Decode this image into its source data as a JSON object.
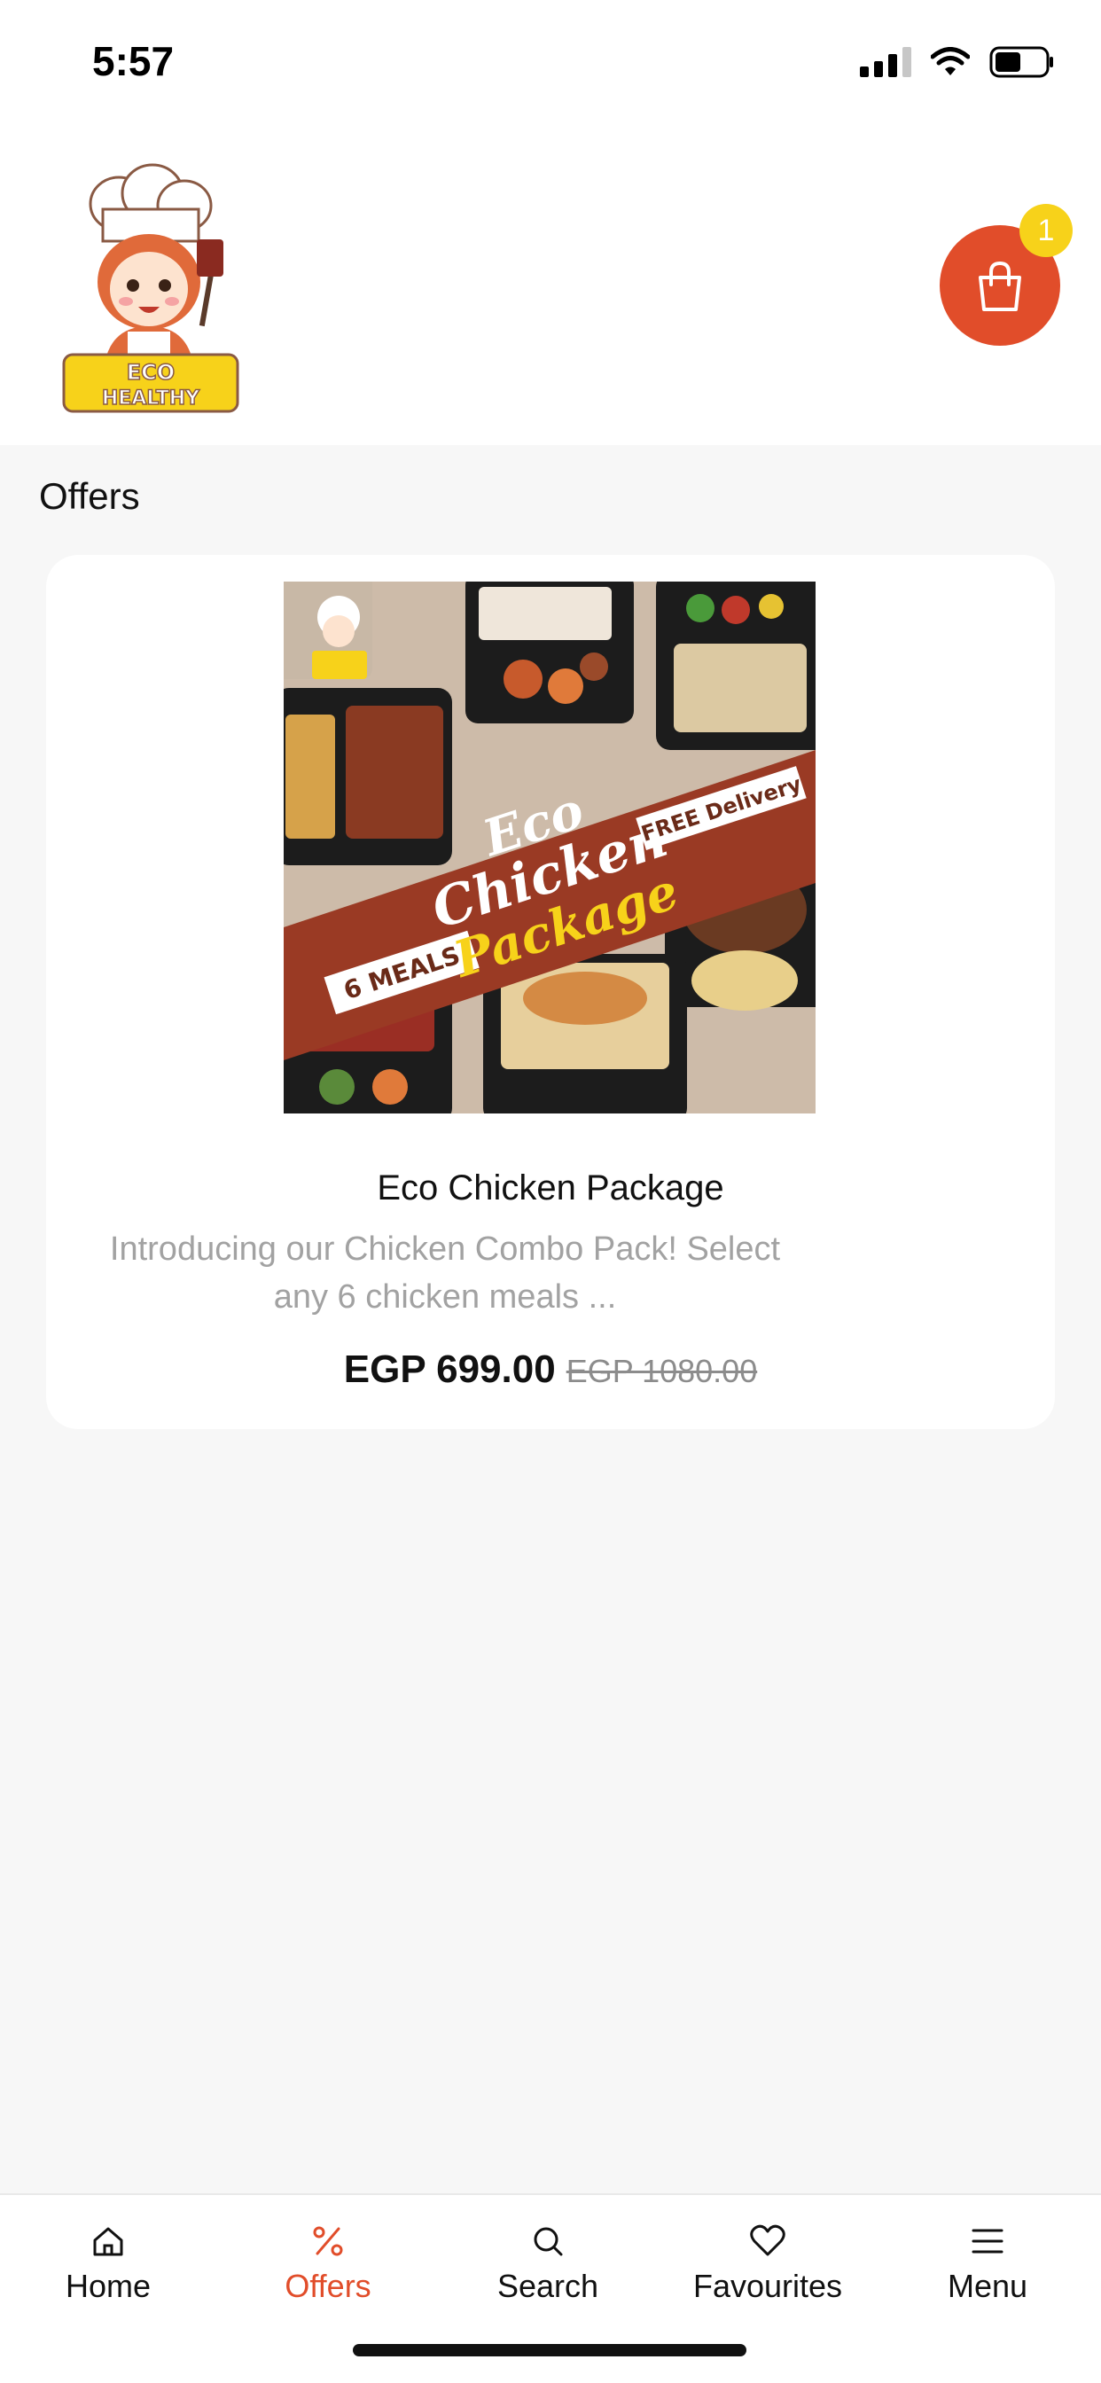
{
  "status_bar": {
    "time": "5:57"
  },
  "header": {
    "logo_text_line1": "ECO",
    "logo_text_line2": "HEALTHY",
    "cart_count": "1",
    "cart_icon": "shopping-bag-icon"
  },
  "offers_section": {
    "title": "Offers",
    "items": [
      {
        "title": "Eco Chicken Package",
        "description": "Introducing our Chicken Combo Pack! Select any 6 chicken meals ...",
        "price": "EGP 699.00",
        "old_price": "EGP 1080.00",
        "image_texts": {
          "line1": "Eco",
          "line2": "Chicken",
          "line3": "Package",
          "meals": "6 MEALS",
          "delivery": "FREE Delivery"
        }
      }
    ]
  },
  "bottom_nav": {
    "items": [
      {
        "label": "Home",
        "icon": "home-icon",
        "active": false
      },
      {
        "label": "Offers",
        "icon": "percent-icon",
        "active": true
      },
      {
        "label": "Search",
        "icon": "search-icon",
        "active": false
      },
      {
        "label": "Favourites",
        "icon": "heart-icon",
        "active": false
      },
      {
        "label": "Menu",
        "icon": "menu-icon",
        "active": false
      }
    ]
  },
  "colors": {
    "accent": "#e14d2a",
    "badge": "#f7d21a",
    "background": "#f7f7f7"
  }
}
